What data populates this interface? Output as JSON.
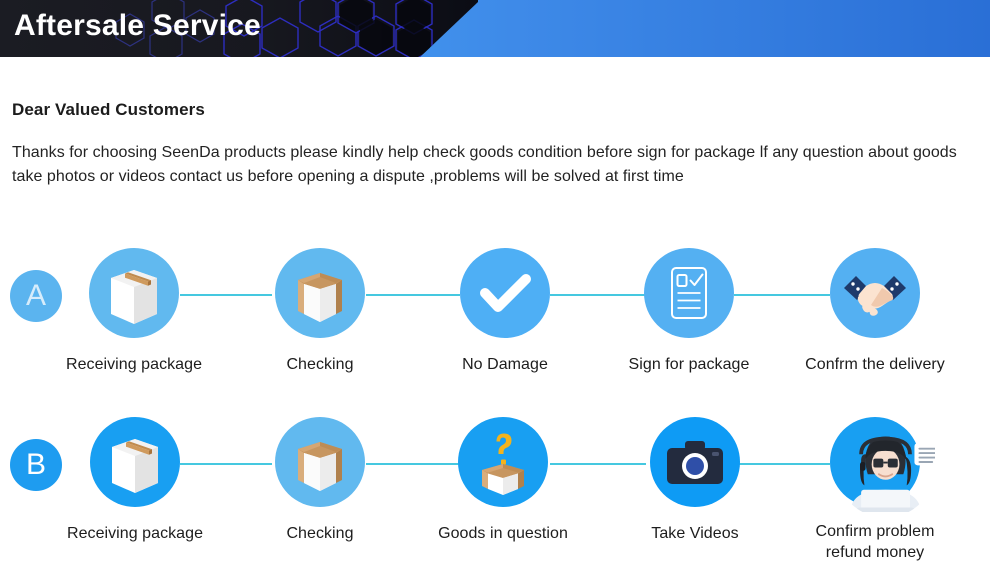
{
  "header": {
    "title": "Aftersale Service",
    "colors": {
      "dark_panel": "#14151c",
      "hex_outline": "#2b2ea8",
      "gradient_start": "#3ad5ee",
      "gradient_end": "#2a6fd6"
    }
  },
  "intro": {
    "greeting": "Dear Valued Customers",
    "body": "Thanks for choosing SeenDa products please kindly help check goods condition before sign for package lf any question about goods take photos or videos contact us before opening a dispute ,problems will be solved at first time"
  },
  "flows": [
    {
      "badge": "A",
      "badge_bg": "#5bb4ef",
      "badge_fg": "#d6ecfb",
      "steps": [
        {
          "label": "Receiving package",
          "icon": "closed-box-icon",
          "circle": "#61b9ef"
        },
        {
          "label": "Checking",
          "icon": "open-box-icon",
          "circle": "#61b9ef"
        },
        {
          "label": "No Damage",
          "icon": "checkmark-icon",
          "circle": "#4eaff5"
        },
        {
          "label": "Sign for package",
          "icon": "clipboard-signature-icon",
          "circle": "#54b0f2"
        },
        {
          "label": "Confrm the delivery",
          "icon": "handshake-icon",
          "circle": "#54b0f2"
        }
      ]
    },
    {
      "badge": "B",
      "badge_bg": "#1e9cf0",
      "badge_fg": "#ffffff",
      "steps": [
        {
          "label": "Receiving package",
          "icon": "closed-box-icon",
          "circle": "#189ff2"
        },
        {
          "label": "Checking",
          "icon": "open-box-icon",
          "circle": "#61b9ef"
        },
        {
          "label": "Goods in question",
          "icon": "question-box-icon",
          "circle": "#189ff2"
        },
        {
          "label": "Take Videos",
          "icon": "camera-icon",
          "circle": "#0e9bf5"
        },
        {
          "label": "Confirm problem\nrefund money",
          "icon": "customer-support-agent-icon",
          "circle": "#189ff2"
        }
      ]
    }
  ],
  "connector_color": "#45c8e0"
}
